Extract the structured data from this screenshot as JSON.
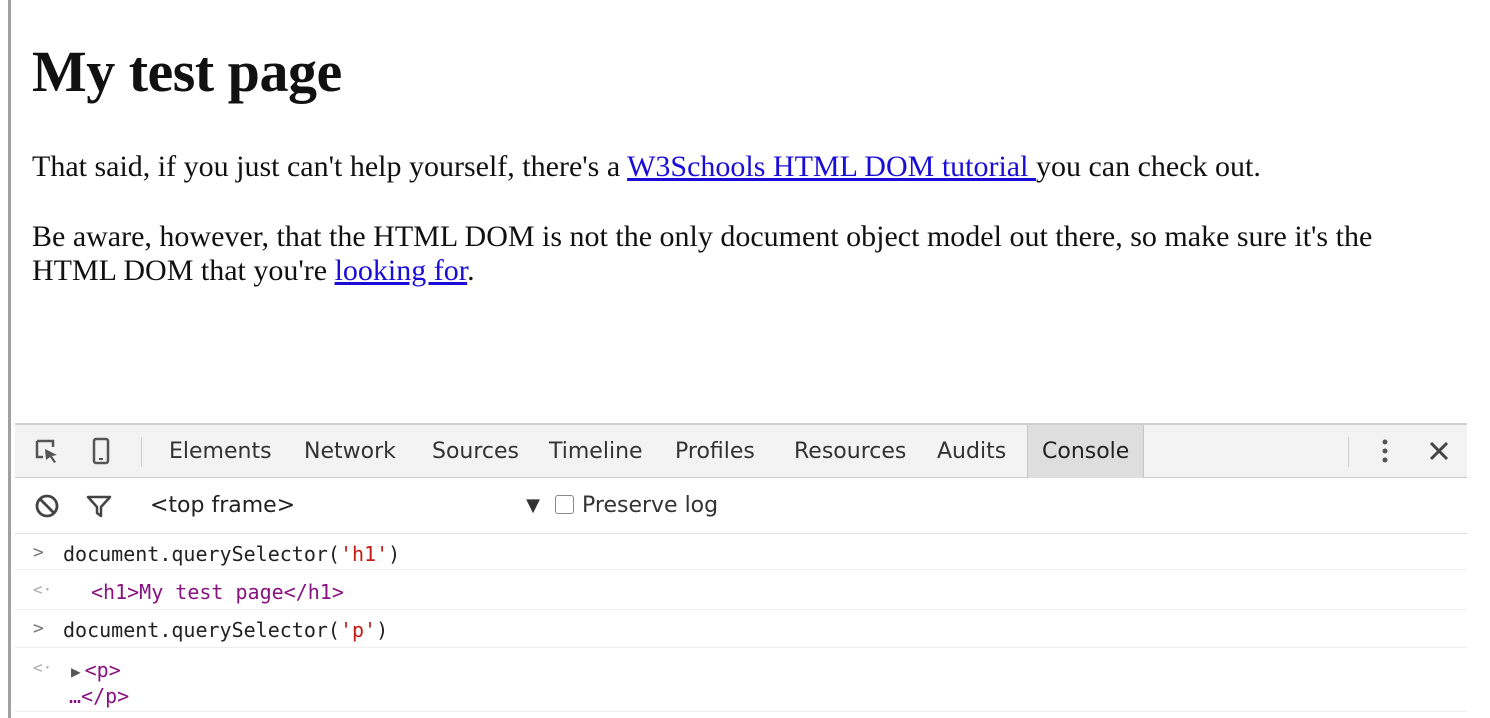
{
  "page": {
    "heading": "My test page",
    "p1": {
      "before": "That said, if you just can't help yourself, there's a ",
      "link": "W3Schools HTML DOM tutorial ",
      "after": "you can check out."
    },
    "p2": {
      "before": "Be aware, however, that the HTML DOM is not the only document object model out there, so make sure it's the HTML DOM that you're ",
      "link": "looking for",
      "after": "."
    }
  },
  "devtools": {
    "tabs": [
      "Elements",
      "Network",
      "Sources",
      "Timeline",
      "Profiles",
      "Resources",
      "Audits",
      "Console"
    ],
    "active_tab": "Console",
    "icons": [
      "inspect-element-icon",
      "device-mode-icon",
      "more-options-icon",
      "close-icon",
      "clear-console-icon",
      "filter-icon",
      "dropdown-arrow-icon",
      "checkbox-icon"
    ],
    "frame_selector": "<top frame>",
    "preserve_log_label": "Preserve log",
    "preserve_log_checked": false,
    "console": {
      "cmd1": {
        "prefix": "document.querySelector(",
        "arg": "'h1'",
        "suffix": ")"
      },
      "res1": {
        "open": "<h1>",
        "text": "My test page",
        "close": "</h1>"
      },
      "cmd2": {
        "prefix": "document.querySelector(",
        "arg": "'p'",
        "suffix": ")"
      },
      "res2": {
        "open": "<p>",
        "ellipsis": "…",
        "close": "</p>"
      }
    }
  }
}
